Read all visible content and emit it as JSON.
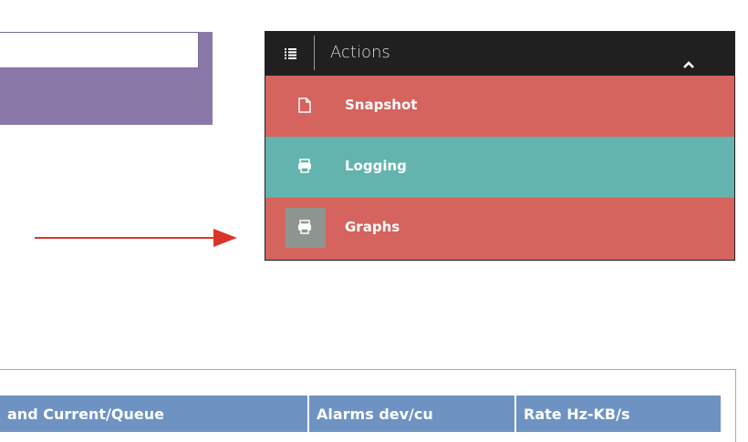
{
  "actions_menu": {
    "title": "Actions",
    "items": [
      {
        "label": "Snapshot",
        "icon": "file-icon"
      },
      {
        "label": "Logging",
        "icon": "printer-icon"
      },
      {
        "label": "Graphs",
        "icon": "printer-icon"
      }
    ]
  },
  "table": {
    "headers": [
      "and Current/Queue",
      "Alarms dev/cu",
      "Rate Hz-KB/s"
    ]
  },
  "colors": {
    "menu_header": "#202020",
    "snapshot_bg": "#d5635e",
    "logging_bg": "#63b3ae",
    "graphs_bg": "#d5635e",
    "left_panel": "#8a79a8",
    "table_header": "#6e93c3",
    "arrow": "#d9352b"
  }
}
